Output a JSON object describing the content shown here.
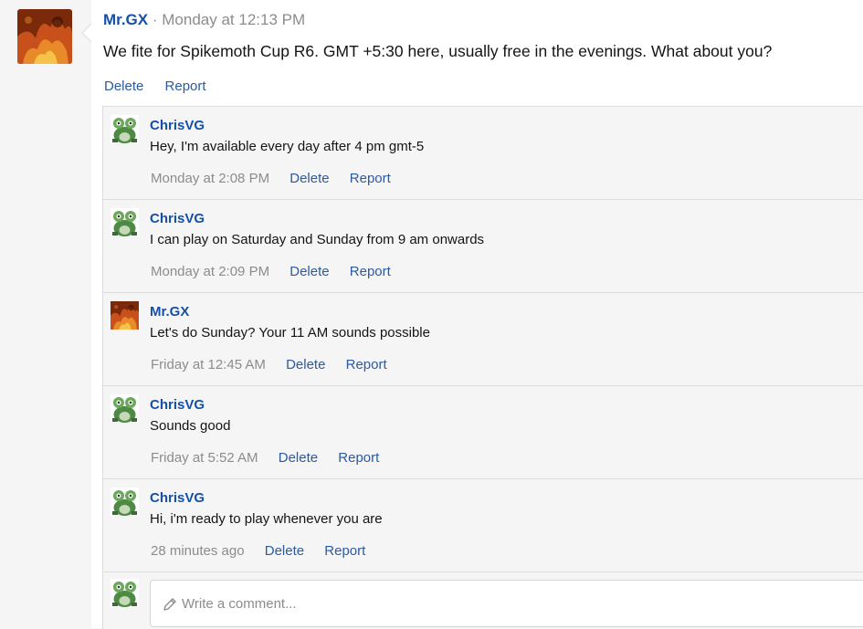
{
  "post": {
    "author": "Mr.GX",
    "separator": "·",
    "time": "Monday at 12:13 PM",
    "text": "We fite for Spikemoth Cup R6. GMT +5:30 here, usually free in the evenings. What about you?",
    "delete_label": "Delete",
    "report_label": "Report"
  },
  "comments": [
    {
      "author": "ChrisVG",
      "avatar": "frog-avatar",
      "text": "Hey, I'm available every day after 4 pm gmt-5",
      "time": "Monday at 2:08 PM",
      "delete_label": "Delete",
      "report_label": "Report"
    },
    {
      "author": "ChrisVG",
      "avatar": "frog-avatar",
      "text": "I can play on Saturday and Sunday from 9 am onwards",
      "time": "Monday at 2:09 PM",
      "delete_label": "Delete",
      "report_label": "Report"
    },
    {
      "author": "Mr.GX",
      "avatar": "fire-avatar",
      "text": "Let's do Sunday? Your 11 AM sounds possible",
      "time": "Friday at 12:45 AM",
      "delete_label": "Delete",
      "report_label": "Report"
    },
    {
      "author": "ChrisVG",
      "avatar": "frog-avatar",
      "text": "Sounds good",
      "time": "Friday at 5:52 AM",
      "delete_label": "Delete",
      "report_label": "Report"
    },
    {
      "author": "ChrisVG",
      "avatar": "frog-avatar",
      "text": "Hi, i'm ready to play whenever you are",
      "time": "28 minutes ago",
      "delete_label": "Delete",
      "report_label": "Report"
    }
  ],
  "reply": {
    "placeholder": "Write a comment...",
    "icon": "pencil-icon"
  },
  "colors": {
    "author": "#1450a8",
    "link": "#2c5aa0",
    "muted": "#8c8c8c",
    "background": "#f5f5f5"
  }
}
